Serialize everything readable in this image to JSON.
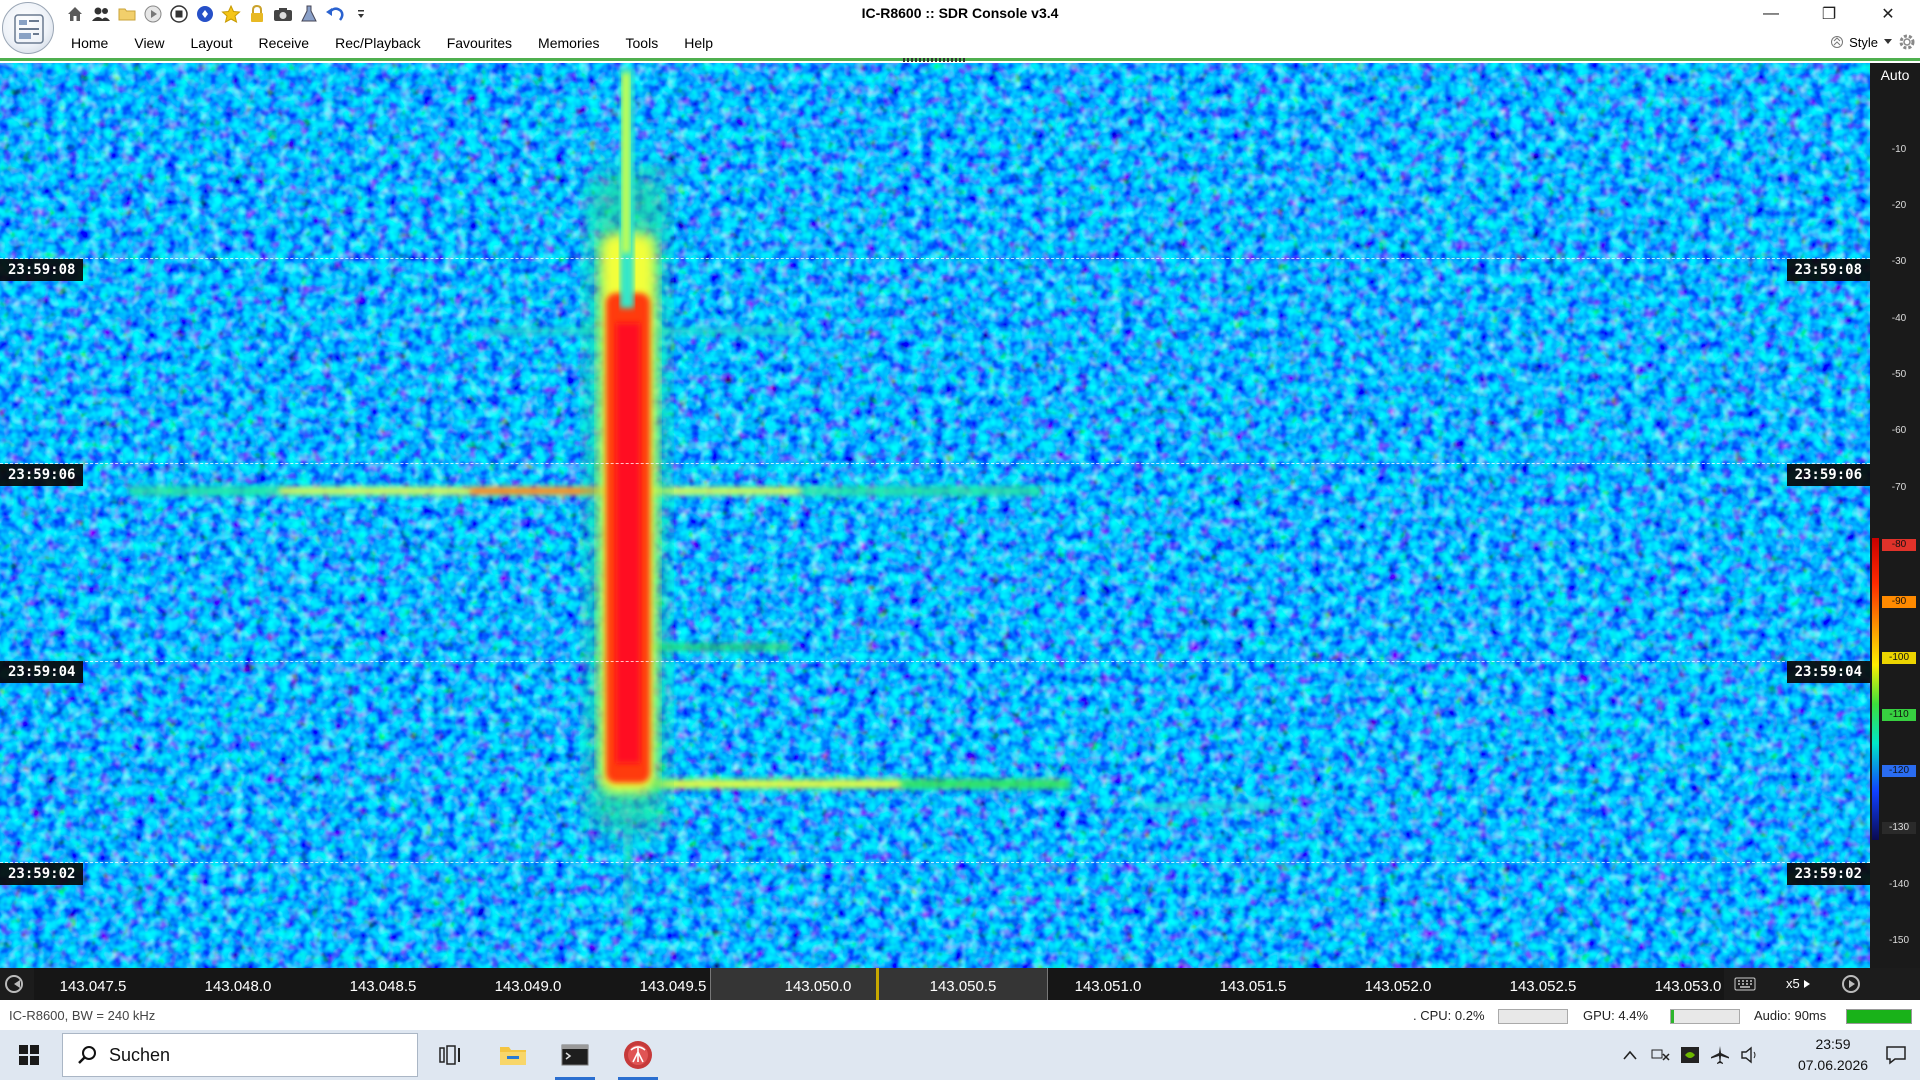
{
  "window": {
    "title": "IC-R8600 :: SDR Console v3.4",
    "minimize_symbol": "—",
    "maximize_symbol": "❐",
    "close_symbol": "✕"
  },
  "quick_access": {
    "icons": [
      "home-icon",
      "users-icon",
      "folder-icon",
      "play-icon",
      "stop-icon",
      "globe-icon",
      "star-icon",
      "lock-icon",
      "camera-icon",
      "flask-icon",
      "undo-icon",
      "dropdown-icon"
    ]
  },
  "menu": {
    "items": [
      "Home",
      "View",
      "Layout",
      "Receive",
      "Rec/Playback",
      "Favourites",
      "Memories",
      "Tools",
      "Help"
    ],
    "style_label": "Style"
  },
  "waterfall": {
    "timestamps": [
      "23:59:08",
      "23:59:06",
      "23:59:04",
      "23:59:02"
    ],
    "colormap": "blue-cyan-green-yellow-red"
  },
  "db_scale": {
    "mode_label": "Auto",
    "ticks": [
      "-10",
      "-20",
      "-30",
      "-40",
      "-50",
      "-60",
      "-70",
      "-80",
      "-90",
      "-100",
      "-110",
      "-120",
      "-130",
      "-140",
      "-150"
    ]
  },
  "frequency": {
    "labels": [
      "143.047.5",
      "143.048.0",
      "143.048.5",
      "143.049.0",
      "143.049.5",
      "143.050.0",
      "143.050.5",
      "143.051.0",
      "143.051.5",
      "143.052.0",
      "143.052.5",
      "143.053.0"
    ],
    "zoom": "x5",
    "highlight_color": "#c8a800"
  },
  "status": {
    "left": "IC-R8600, BW = 240 kHz",
    "cpu": ". CPU: 0.2%",
    "gpu": "GPU: 4.4%",
    "gpu_level": 0.04,
    "audio": "Audio: 90ms",
    "audio_level": 1.0
  },
  "taskbar": {
    "search_placeholder": "Suchen",
    "clock_time": "23:59",
    "clock_date": "07.06.2026"
  }
}
